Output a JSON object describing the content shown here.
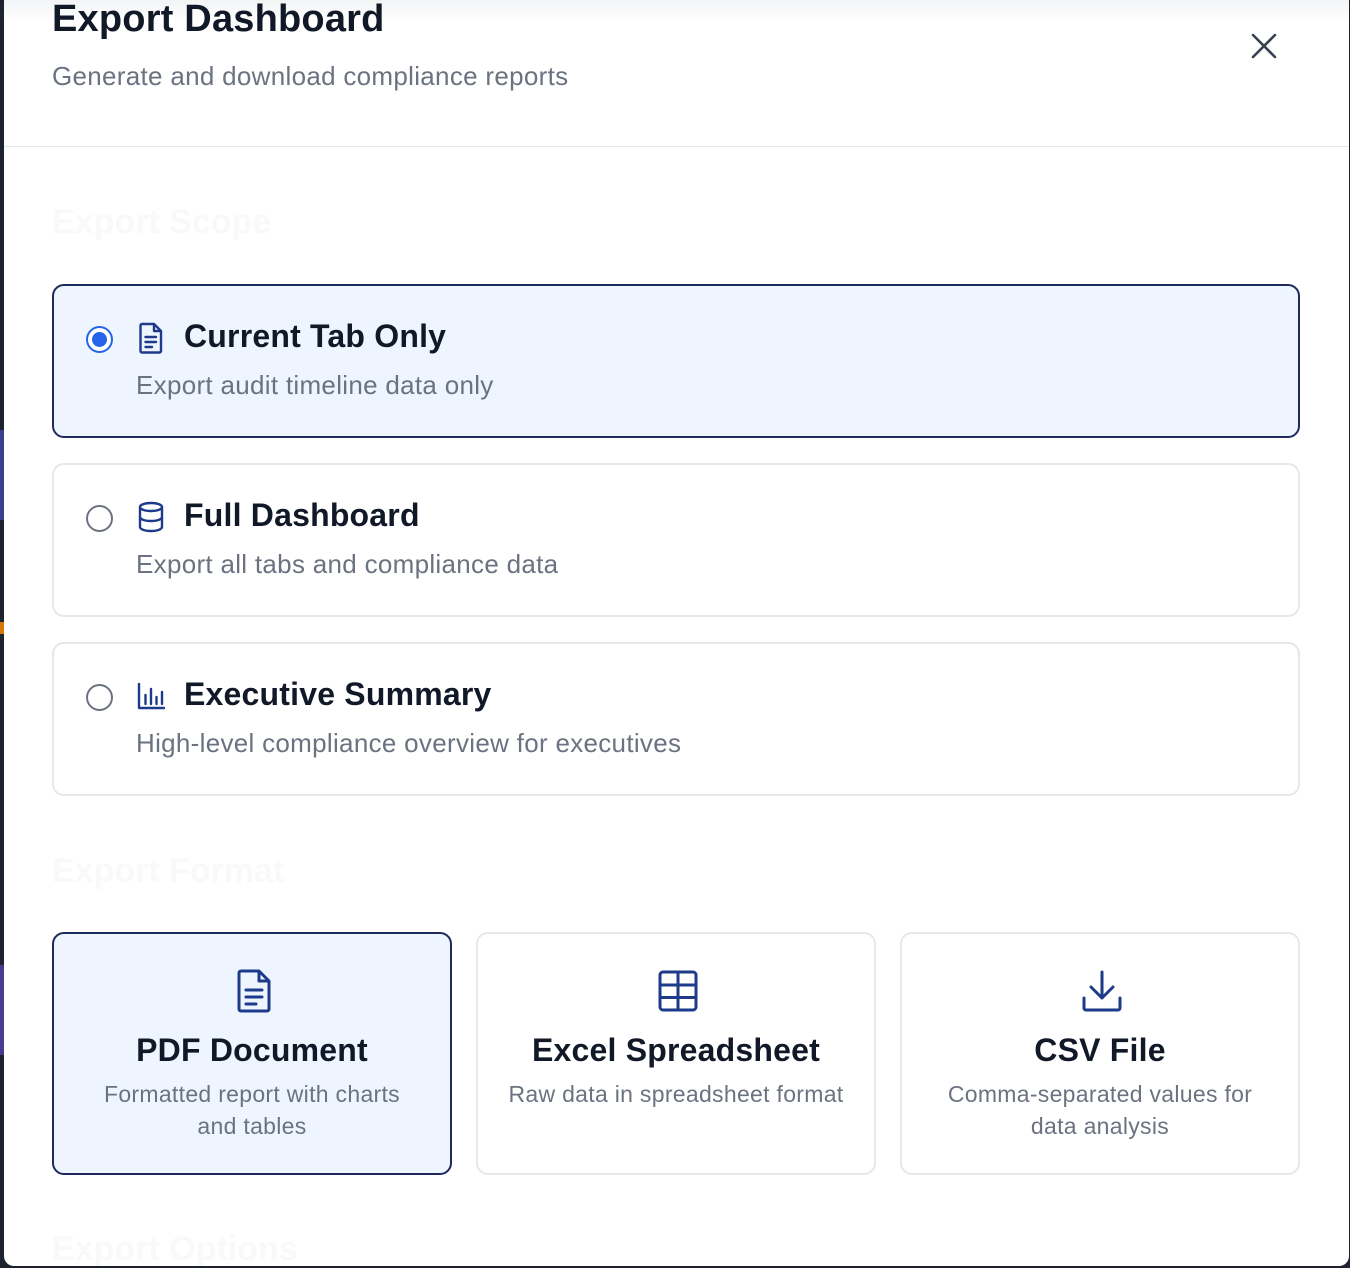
{
  "header": {
    "title": "Export Dashboard",
    "subtitle": "Generate and download compliance reports"
  },
  "sections": {
    "scope_heading": "Export Scope",
    "format_heading": "Export Format",
    "options_heading": "Export Options"
  },
  "scope_options": [
    {
      "label": "Current Tab Only",
      "description": "Export audit timeline data only",
      "icon": "document-icon",
      "selected": true
    },
    {
      "label": "Full Dashboard",
      "description": "Export all tabs and compliance data",
      "icon": "database-icon",
      "selected": false
    },
    {
      "label": "Executive Summary",
      "description": "High-level compliance overview for executives",
      "icon": "bar-chart-icon",
      "selected": false
    }
  ],
  "format_options": [
    {
      "label": "PDF Document",
      "description": "Formatted report with charts and tables",
      "icon": "document-icon",
      "selected": true
    },
    {
      "label": "Excel Spreadsheet",
      "description": "Raw data in spreadsheet format",
      "icon": "table-icon",
      "selected": false
    },
    {
      "label": "CSV File",
      "description": "Comma-separated values for data analysis",
      "icon": "download-icon",
      "selected": false
    }
  ],
  "colors": {
    "accent": "#2563eb",
    "selected_border": "#1e2a5e",
    "selected_bg": "#eef5fe",
    "icon_navy": "#1e3a8a"
  }
}
